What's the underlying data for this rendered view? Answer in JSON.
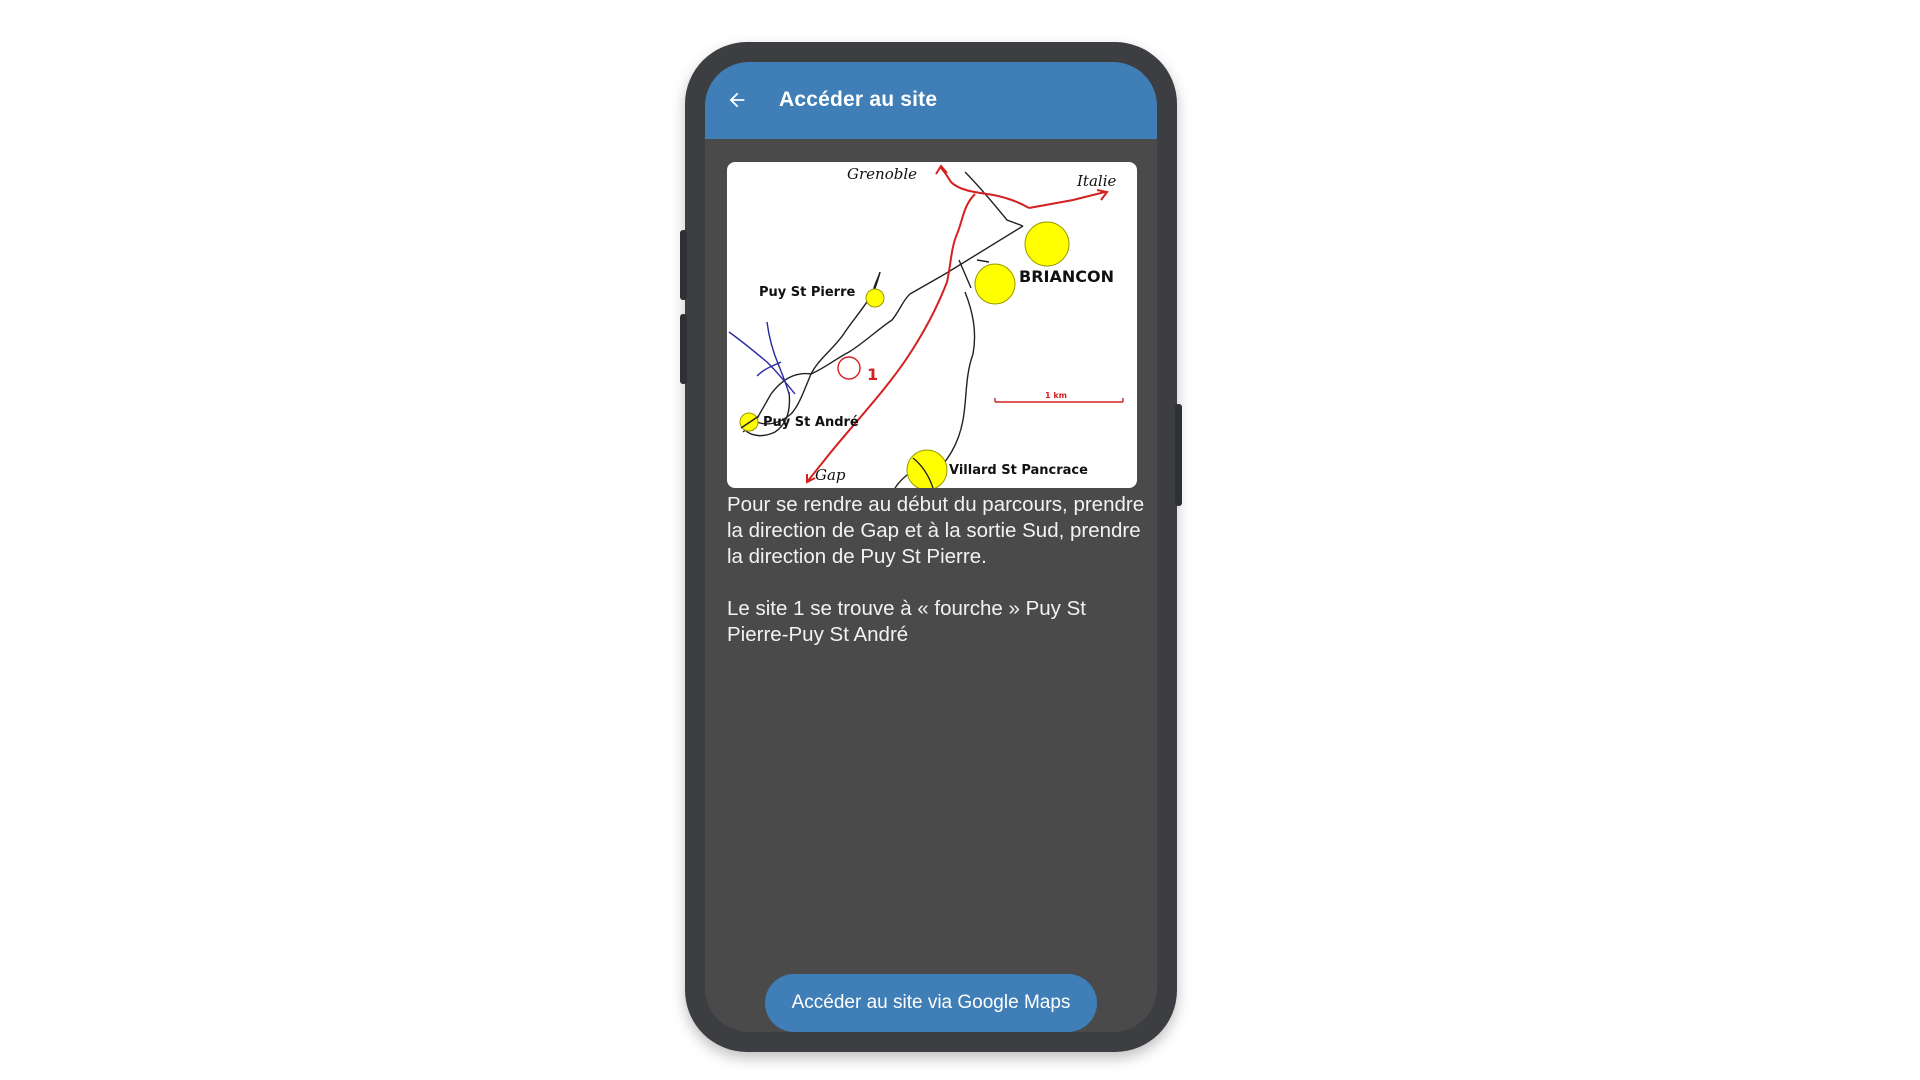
{
  "appbar": {
    "back_icon": "arrow-left-icon",
    "title": "Accéder au site"
  },
  "map": {
    "labels": {
      "grenoble": "Grenoble",
      "italie": "Italie",
      "briancon": "BRIANCON",
      "puy_st_pierre": "Puy St Pierre",
      "site_number": "1",
      "puy_st_andre": "Puy St André",
      "gap": "Gap",
      "villard": "Villard St Pancrace",
      "scale": "1 km"
    },
    "colors": {
      "town_marker": "#ffff00",
      "main_road": "#d42020",
      "river": "#2a2aa0",
      "road": "#222222"
    }
  },
  "content": {
    "paragraph1": "Pour se rendre au début du parcours, prendre la direction de Gap et à la sortie Sud, prendre la direction de Puy St Pierre.",
    "paragraph2": "Le site 1 se trouve à « fourche » Puy St Pierre-Puy St André"
  },
  "actions": {
    "maps_button": "Accéder au site via Google Maps"
  },
  "theme": {
    "accent": "#3f7eb6",
    "screen_background": "#4a4a4b"
  }
}
